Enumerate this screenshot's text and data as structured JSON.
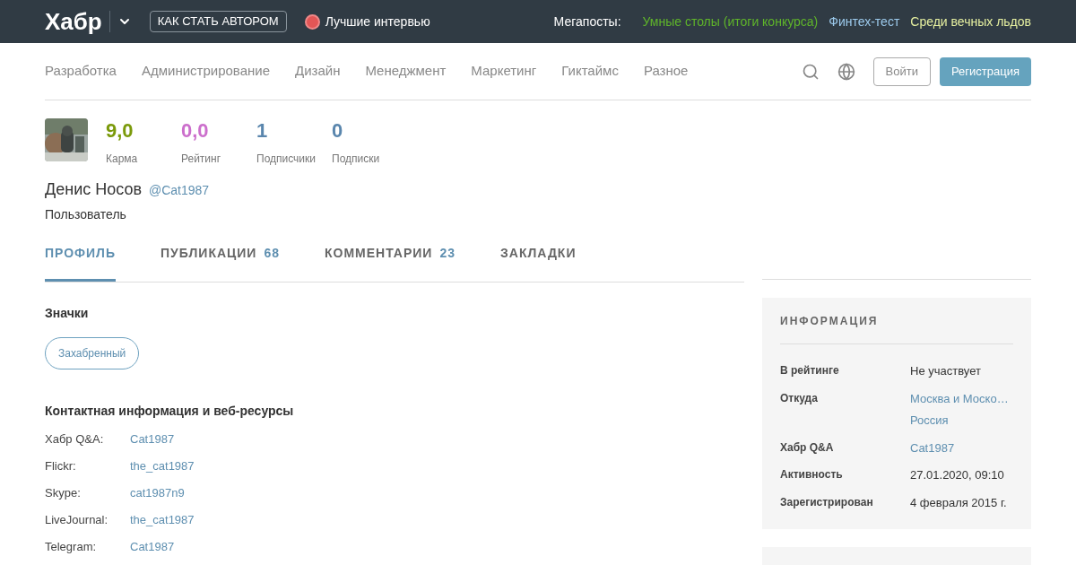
{
  "topbar": {
    "logo": "Хабр",
    "author_button": "КАК СТАТЬ АВТОРОМ",
    "promo": "Лучшие интервью",
    "megaposts_label": "Мегапосты:",
    "megaposts": [
      {
        "title": "Умные столы (итоги конкурса)",
        "color": "#5fb52a"
      },
      {
        "title": "Финтех-тест",
        "color": "#9ccaec"
      },
      {
        "title": "Среди вечных льдов",
        "color": "#e6f0a0"
      }
    ]
  },
  "nav": {
    "items": [
      "Разработка",
      "Администрирование",
      "Дизайн",
      "Менеджмент",
      "Маркетинг",
      "Гиктаймс",
      "Разное"
    ],
    "login": "Войти",
    "register": "Регистрация"
  },
  "profile": {
    "stats": [
      {
        "value": "9,0",
        "label": "Карма",
        "color": "#7b9a0b"
      },
      {
        "value": "0,0",
        "label": "Рейтинг",
        "color": "#cc6fcc"
      },
      {
        "value": "1",
        "label": "Подписчики",
        "color": "#5a86ad"
      },
      {
        "value": "0",
        "label": "Подписки",
        "color": "#5a86ad"
      }
    ],
    "name": "Денис Носов",
    "nickname": "@Cat1987",
    "role": "Пользователь"
  },
  "tabs": [
    {
      "label": "ПРОФИЛЬ",
      "selected": true
    },
    {
      "label": "ПУБЛИКАЦИИ",
      "count": "68",
      "selected": false
    },
    {
      "label": "КОММЕНТАРИИ",
      "count": "23",
      "selected": false
    },
    {
      "label": "ЗАКЛАДКИ",
      "selected": false
    }
  ],
  "badges": {
    "title": "Значки",
    "items": [
      "Захабренный"
    ]
  },
  "contacts": {
    "title": "Контактная информация и веб-ресурсы",
    "rows": [
      {
        "label": "Хабр Q&A:",
        "value": "Cat1987"
      },
      {
        "label": "Flickr:",
        "value": "the_cat1987"
      },
      {
        "label": "Skype:",
        "value": "cat1987n9"
      },
      {
        "label": "LiveJournal:",
        "value": "the_cat1987"
      },
      {
        "label": "Telegram:",
        "value": "Cat1987"
      }
    ]
  },
  "info": {
    "title": "ИНФОРМАЦИЯ",
    "rows": [
      {
        "label": "В рейтинге",
        "values": [
          "Не участвует"
        ],
        "kind": "text"
      },
      {
        "label": "Откуда",
        "values": [
          "Москва и Моско…",
          "Россия"
        ],
        "kind": "link"
      },
      {
        "label": "Хабр Q&A",
        "values": [
          "Cat1987"
        ],
        "kind": "link"
      },
      {
        "label": "Активность",
        "values": [
          "27.01.2020, 09:10"
        ],
        "kind": "text"
      },
      {
        "label": "Зарегистрирован",
        "values": [
          "4 февраля 2015 г."
        ],
        "kind": "text"
      }
    ]
  }
}
